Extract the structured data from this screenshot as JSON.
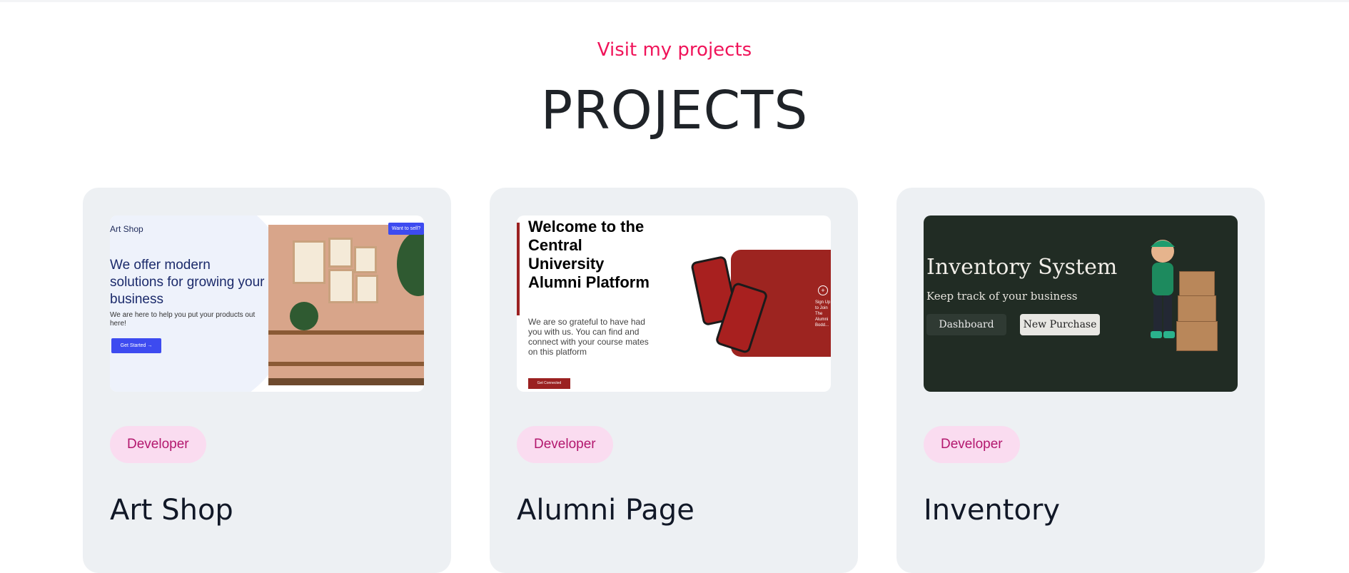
{
  "section": {
    "subtitle": "Visit my projects",
    "title": "PROJECTS"
  },
  "projects": [
    {
      "title": "Art Shop",
      "badge": "Developer",
      "thumb": {
        "brand": "Art Shop",
        "headline": "We offer modern solutions for growing your business",
        "text": "We are here to help you put your products out here!",
        "button": "Get Started →",
        "tag": "Want to sell?"
      }
    },
    {
      "title": "Alumni Page",
      "badge": "Developer",
      "thumb": {
        "headline": "Welcome to the Central University Alumni Platform",
        "text": "We are so grateful to have had you with us. You can find and connect with your course mates on this platform",
        "button": "Get Connected",
        "side_text": "Sign Up to Join The Alumni Bodd..."
      }
    },
    {
      "title": "Inventory",
      "badge": "Developer",
      "thumb": {
        "title": "Inventory System",
        "subtitle": "Keep track of your business",
        "button1": "Dashboard",
        "button2": "New Purchase"
      }
    }
  ],
  "colors": {
    "accent": "#f0145a",
    "card_bg": "#edf0f3",
    "badge_bg": "#fadcf0",
    "badge_text": "#b3186e",
    "inventory_bg": "#212c24",
    "alumni_red": "#9d2420"
  }
}
